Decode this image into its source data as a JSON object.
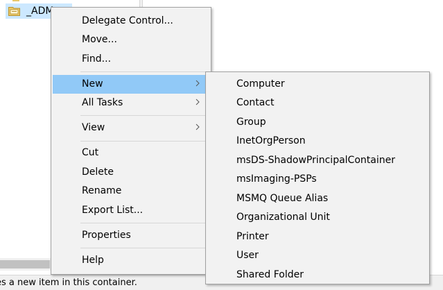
{
  "tree": {
    "selected_item_label": "_ADM"
  },
  "status_bar": {
    "text": "es a new item in this container."
  },
  "context_menu": {
    "items": [
      {
        "label": "Delegate Control..."
      },
      {
        "label": "Move..."
      },
      {
        "label": "Find..."
      },
      {
        "label": "New",
        "has_submenu": true,
        "highlighted": true
      },
      {
        "label": "All Tasks",
        "has_submenu": true
      },
      {
        "label": "View",
        "has_submenu": true
      },
      {
        "label": "Cut"
      },
      {
        "label": "Delete"
      },
      {
        "label": "Rename"
      },
      {
        "label": "Export List..."
      },
      {
        "label": "Properties"
      },
      {
        "label": "Help"
      }
    ]
  },
  "new_submenu": {
    "items": [
      {
        "label": "Computer"
      },
      {
        "label": "Contact"
      },
      {
        "label": "Group"
      },
      {
        "label": "InetOrgPerson"
      },
      {
        "label": "msDS-ShadowPrincipalContainer"
      },
      {
        "label": "msImaging-PSPs"
      },
      {
        "label": "MSMQ Queue Alias"
      },
      {
        "label": "Organizational Unit"
      },
      {
        "label": "Printer"
      },
      {
        "label": "User"
      },
      {
        "label": "Shared Folder"
      }
    ]
  },
  "colors": {
    "menu_background": "#f2f2f2",
    "highlight": "#91c9f7",
    "tree_selection": "#cce8ff",
    "folder": "#e8c86b"
  },
  "icons": {
    "tree_item": "folder-icon",
    "submenu_indicator": "chevron-right-icon"
  }
}
